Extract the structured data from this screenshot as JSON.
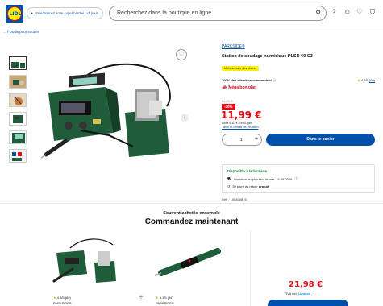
{
  "header": {
    "store_selector": "Sélectionnez votre supermarché Lidl pour...",
    "search_placeholder": "Recherchez dans la boutique en ligne",
    "logo_text": "LIDL"
  },
  "breadcrumb": "... / Outils pour souder",
  "product": {
    "brand": "PARKSIDE®",
    "title": "Station de soudage numérique PLSD 60 C3",
    "badge": "Meilleur avis des clients",
    "recommend": "100% des clients recommandent",
    "rating": "4.8/5",
    "rating_count": "(60)",
    "deal_label": "Méga bon plan",
    "old_price": "14,99 €",
    "discount": "-20%",
    "price": "11,99 €",
    "unit_price": "Dont 0,10 € d'éco-part",
    "tax_link": "Tarifs et détails de livraison",
    "quantity": "1",
    "add_to_cart": "Dans le panier"
  },
  "availability": {
    "title": "Disponible à la livraison",
    "delivery": "Livraison au plus tard le mer. 16.09.2026",
    "returns_prefix": "30 jours de retour ",
    "returns_bold": "gratuit"
  },
  "reference": "Réf. : 100400876",
  "bundle": {
    "subtitle": "Souvent achetés ensemble",
    "title": "Commandez maintenant",
    "item1_rating": "4.8/5 (60)",
    "item1_brand": "PARKSIDE®",
    "item2_rating": "4.1/5 (84)",
    "item2_brand": "PARKSIDE®",
    "total_price": "21,98 €",
    "tax_prefix": "TVA incl. ",
    "tax_link": "Livraison"
  },
  "colors": {
    "brand_blue": "#0050aa",
    "sale_red": "#e60a14",
    "badge_yellow": "#fff000",
    "product_green": "#1f5c3a"
  }
}
